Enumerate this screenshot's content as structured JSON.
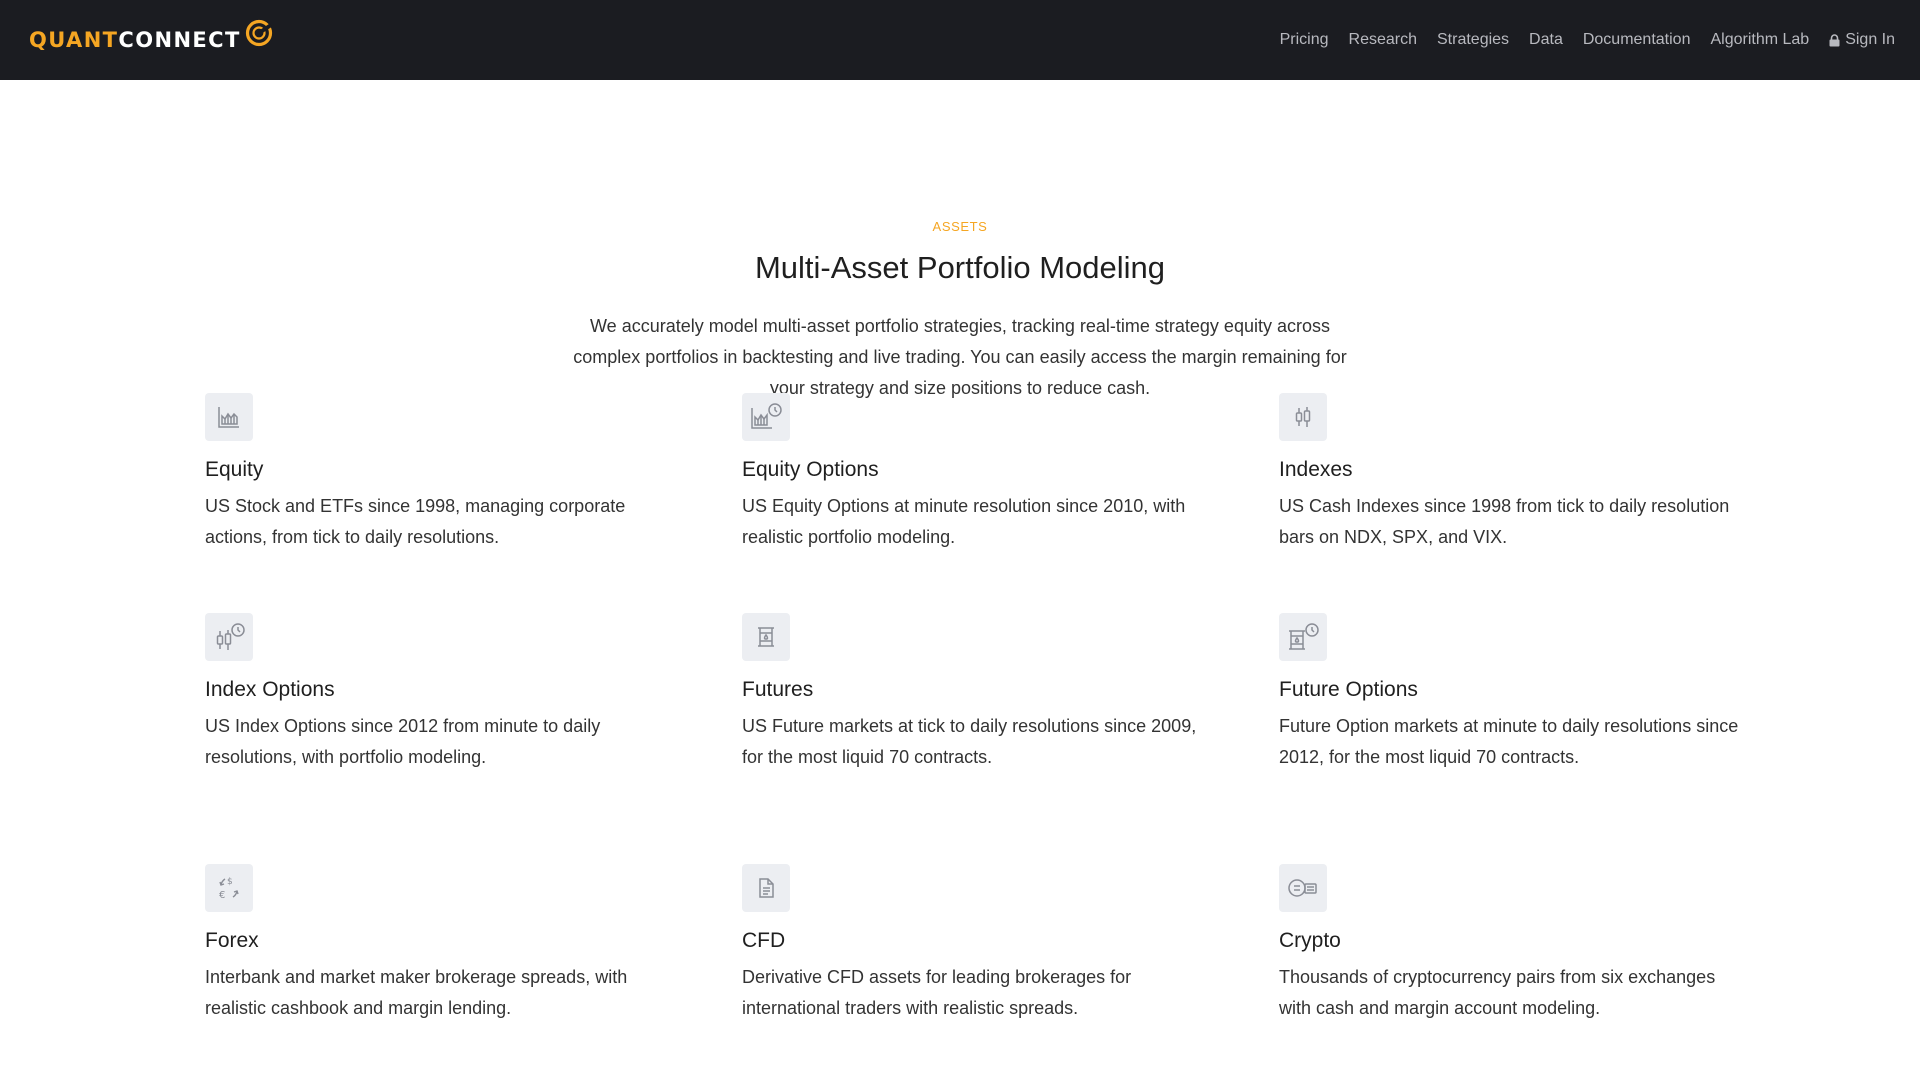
{
  "brand": {
    "quant": "QUANT",
    "connect": "CONNECT",
    "accent_color": "#f5a623",
    "header_bg": "#1b1c21"
  },
  "nav": {
    "items": [
      {
        "label": "Pricing"
      },
      {
        "label": "Research"
      },
      {
        "label": "Strategies"
      },
      {
        "label": "Data"
      },
      {
        "label": "Documentation"
      },
      {
        "label": "Algorithm Lab"
      }
    ],
    "signin": {
      "label": "Sign In",
      "icon": "lock-icon"
    }
  },
  "section": {
    "eyebrow": "ASSETS",
    "title": "Multi-Asset Portfolio Modeling",
    "intro": "We accurately model multi-asset portfolio strategies, tracking real-time strategy equity across complex portfolios in backtesting and live trading. You can easily access the margin remaining for your strategy and size positions to reduce cash."
  },
  "assets": [
    {
      "icon": "equity-chart-icon",
      "title": "Equity",
      "description": "US Stock and ETFs since 1998, managing corporate actions, from tick to daily resolutions."
    },
    {
      "icon": "equity-options-icon",
      "title": "Equity Options",
      "description": "US Equity Options at minute resolution since 2010, with realistic portfolio modeling."
    },
    {
      "icon": "candlestick-icon",
      "title": "Indexes",
      "description": "US Cash Indexes since 1998 from tick to daily resolution bars on NDX, SPX, and VIX."
    },
    {
      "icon": "candlestick-clock-icon",
      "title": "Index Options",
      "description": "US Index Options since 2012 from minute to daily resolutions, with portfolio modeling."
    },
    {
      "icon": "oil-barrel-icon",
      "title": "Futures",
      "description": "US Future markets at tick to daily resolutions since 2009, for the most liquid 70 contracts."
    },
    {
      "icon": "oil-barrel-clock-icon",
      "title": "Future Options",
      "description": "Future Option markets at minute to daily resolutions since 2012, for the most liquid 70 contracts."
    },
    {
      "icon": "currency-exchange-icon",
      "title": "Forex",
      "description": "Interbank and market maker brokerage spreads, with realistic cashbook and margin lending."
    },
    {
      "icon": "document-icon",
      "title": "CFD",
      "description": "Derivative CFD assets for leading brokerages for international traders with realistic spreads."
    },
    {
      "icon": "crypto-coins-icon",
      "title": "Crypto",
      "description": "Thousands of cryptocurrency pairs from six exchanges with cash and margin account modeling."
    }
  ]
}
